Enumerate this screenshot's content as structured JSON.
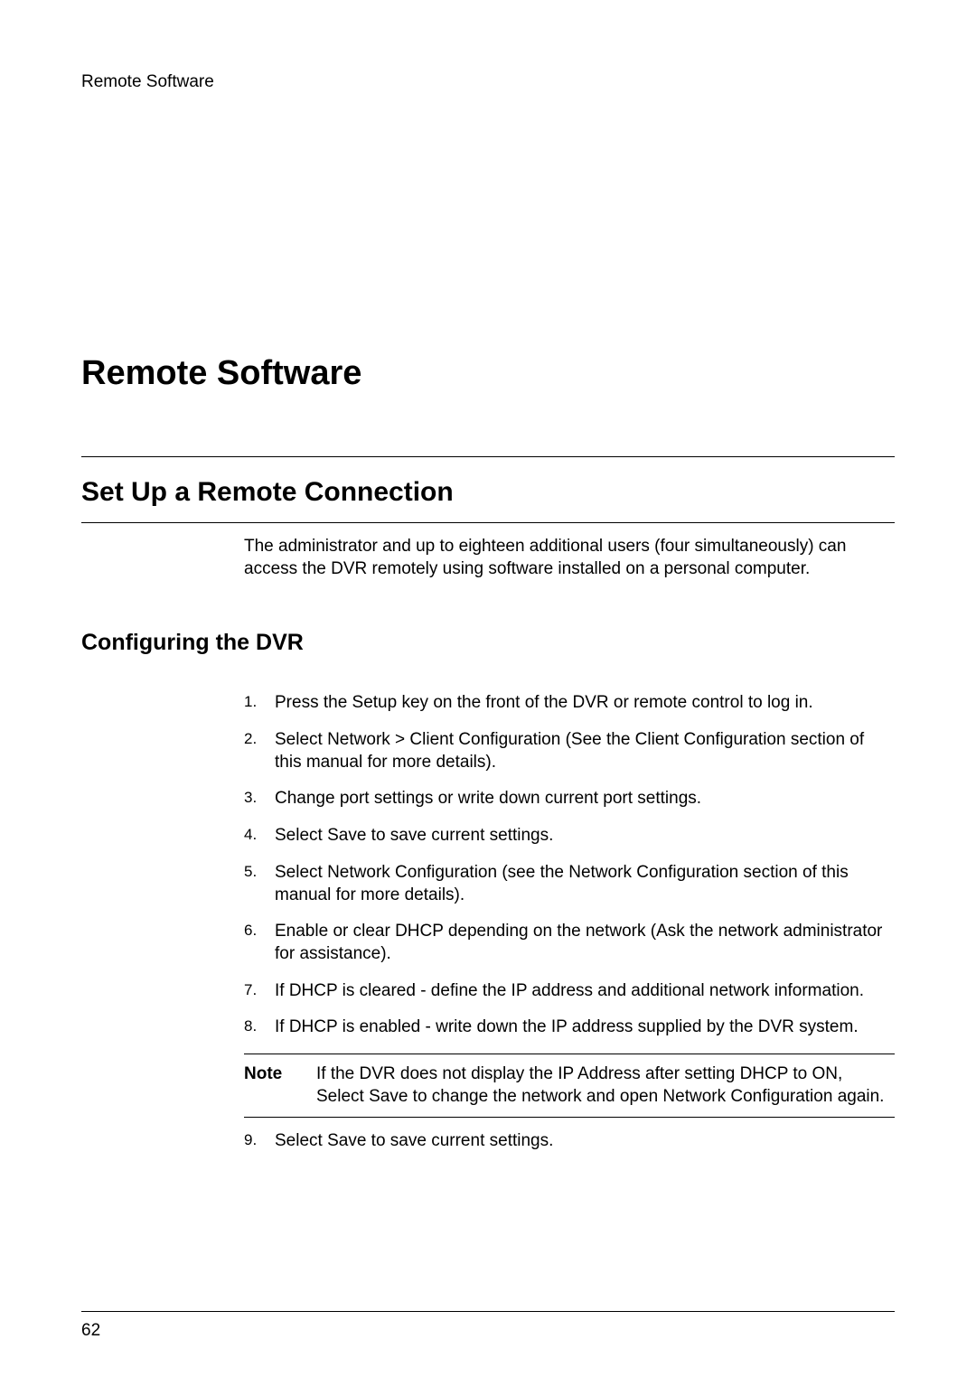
{
  "header": "Remote Software",
  "chapterTitle": "Remote Software",
  "sectionTitle": "Set Up a Remote Connection",
  "introText": "The administrator and up to eighteen additional users (four simultaneously) can access the DVR remotely using software installed on a personal computer.",
  "subsectionTitle": "Configuring the DVR",
  "steps": {
    "s1": {
      "num": "1.",
      "text": "Press the Setup key on the front of the DVR or remote control to log in."
    },
    "s2": {
      "num": "2.",
      "text": "Select Network > Client Configuration (See the Client Configuration section of this manual for more details)."
    },
    "s3": {
      "num": "3.",
      "text": "Change port settings or write down current port settings."
    },
    "s4": {
      "num": "4.",
      "text": "Select Save to save current settings."
    },
    "s5": {
      "num": "5.",
      "text": "Select Network Configuration (see the Network Configuration section of this manual for more details)."
    },
    "s6": {
      "num": "6.",
      "text": "Enable or clear DHCP depending on the network (Ask the network administrator for assistance)."
    },
    "s7": {
      "num": "7.",
      "text": "If DHCP is cleared - define the IP address and additional network information."
    },
    "s8": {
      "num": "8.",
      "text": "If DHCP is enabled - write down the IP address supplied by the DVR system."
    },
    "s9": {
      "num": "9.",
      "text": "Select Save to save current settings."
    }
  },
  "note": {
    "label": "Note",
    "text": "If the DVR does not display the IP Address after setting DHCP to ON, Select Save to change the network and open Network Configuration again."
  },
  "pageNumber": "62"
}
